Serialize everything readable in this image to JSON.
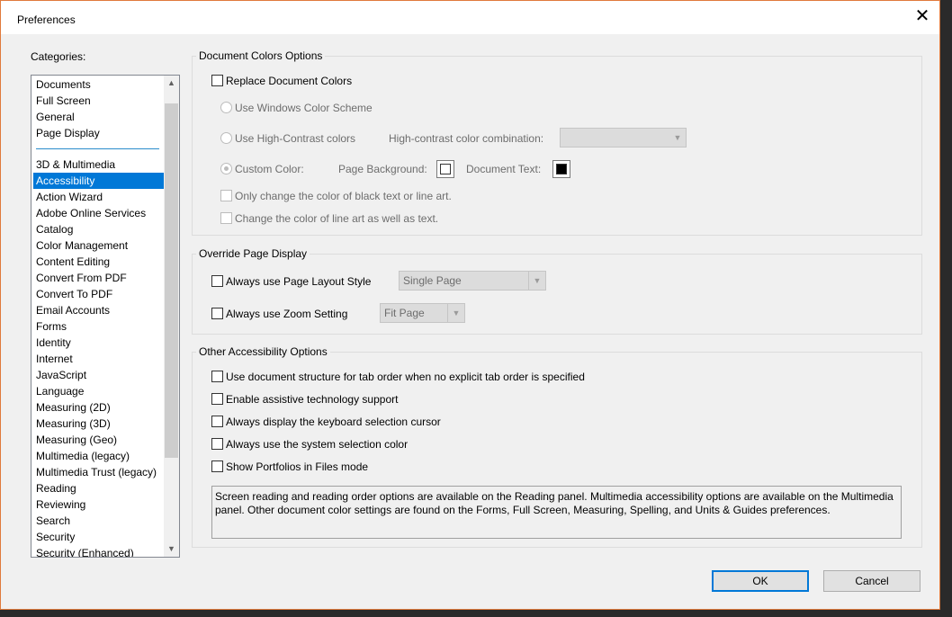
{
  "window": {
    "title": "Preferences",
    "close_glyph": "✕"
  },
  "categories": {
    "label": "Categories:",
    "items": [
      "Documents",
      "Full Screen",
      "General",
      "Page Display",
      "3D & Multimedia",
      "Accessibility",
      "Action Wizard",
      "Adobe Online Services",
      "Catalog",
      "Color Management",
      "Content Editing",
      "Convert From PDF",
      "Convert To PDF",
      "Email Accounts",
      "Forms",
      "Identity",
      "Internet",
      "JavaScript",
      "Language",
      "Measuring (2D)",
      "Measuring (3D)",
      "Measuring (Geo)",
      "Multimedia (legacy)",
      "Multimedia Trust (legacy)",
      "Reading",
      "Reviewing",
      "Search",
      "Security",
      "Security (Enhanced)"
    ],
    "selected": "Accessibility"
  },
  "doc_colors": {
    "title": "Document Colors Options",
    "replace": "Replace Document Colors",
    "windows_scheme": "Use Windows Color Scheme",
    "high_contrast": "Use High-Contrast colors",
    "hc_combo_label": "High-contrast color combination:",
    "hc_combo_value": "",
    "custom": "Custom Color:",
    "page_bg": "Page Background:",
    "doc_text": "Document Text:",
    "page_bg_color": "#ffffff",
    "doc_text_color": "#000000",
    "only_black": "Only change the color of black text or line art.",
    "line_art": "Change the color of line art as well as text."
  },
  "override": {
    "title": "Override Page Display",
    "layout_label": "Always use Page Layout Style",
    "layout_value": "Single Page",
    "zoom_label": "Always use Zoom Setting",
    "zoom_value": "Fit Page"
  },
  "other": {
    "title": "Other Accessibility Options",
    "tab_order": "Use document structure for tab order when no explicit tab order is specified",
    "assistive": "Enable assistive technology support",
    "keyboard_cursor": "Always display the keyboard selection cursor",
    "system_color": "Always use the system selection color",
    "portfolios": "Show Portfolios in Files mode",
    "info_text": "Screen reading and reading order options are available on the Reading panel. Multimedia accessibility options are available on the Multimedia panel. Other document color settings are found on the Forms, Full Screen, Measuring, Spelling, and Units & Guides preferences."
  },
  "buttons": {
    "ok": "OK",
    "cancel": "Cancel"
  },
  "colors": {
    "accent": "#0078d7",
    "dialog_border": "#e07a3c"
  }
}
